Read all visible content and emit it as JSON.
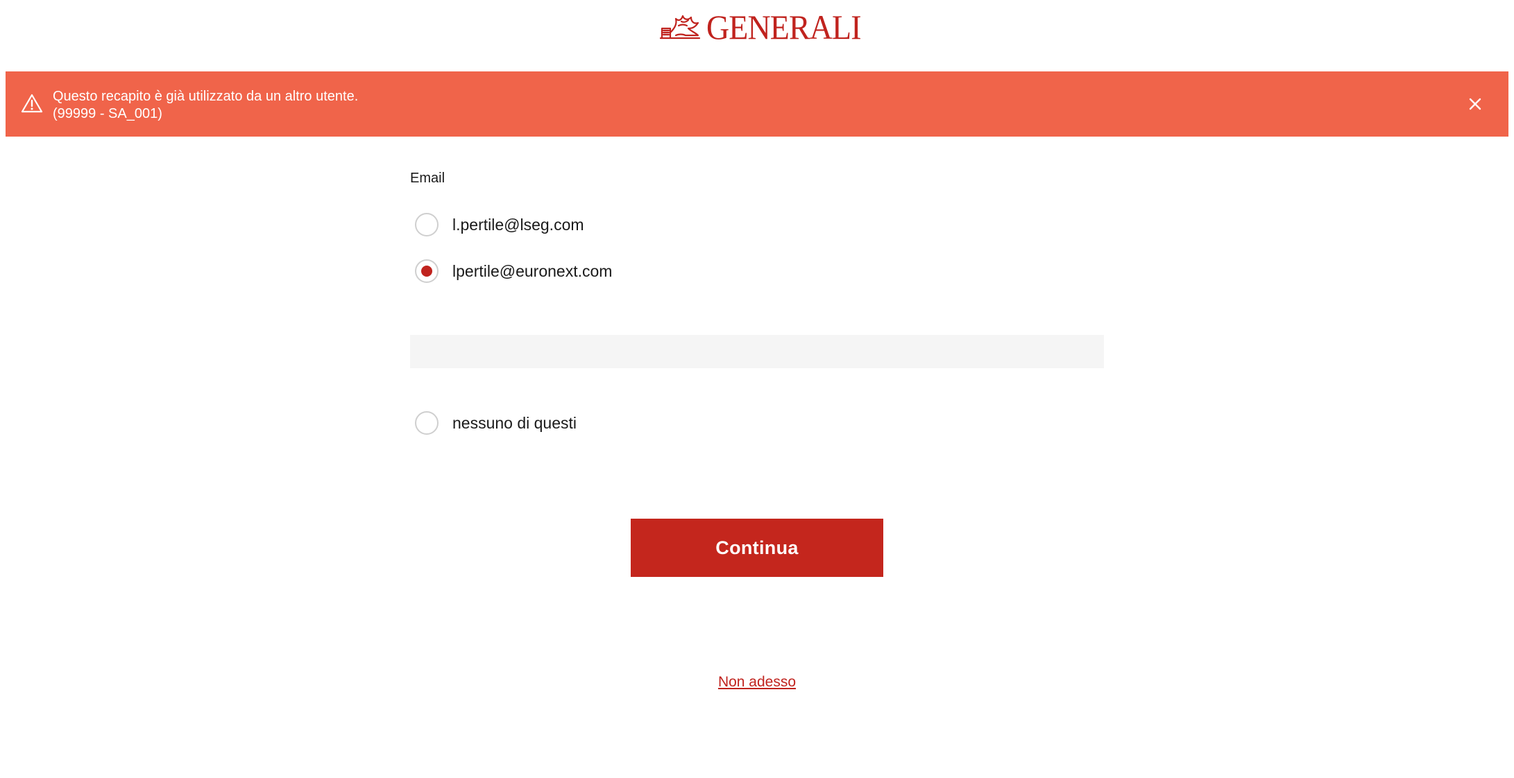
{
  "brand": {
    "name": "GENERALI",
    "color": "#c0231e"
  },
  "alert": {
    "message": "Questo recapito è già utilizzato da un altro utente.",
    "code": "(99999 - SA_001)",
    "icon": "warning-icon",
    "close_icon": "close-icon",
    "background": "#f0644a"
  },
  "form": {
    "label": "Email",
    "options": [
      {
        "label": "l.pertile@lseg.com",
        "checked": false
      },
      {
        "label": "lpertile@euronext.com",
        "checked": true
      },
      {
        "label": "nessuno di questi",
        "checked": false
      }
    ]
  },
  "actions": {
    "continue_label": "Continua",
    "not_now_label": "Non adesso"
  }
}
